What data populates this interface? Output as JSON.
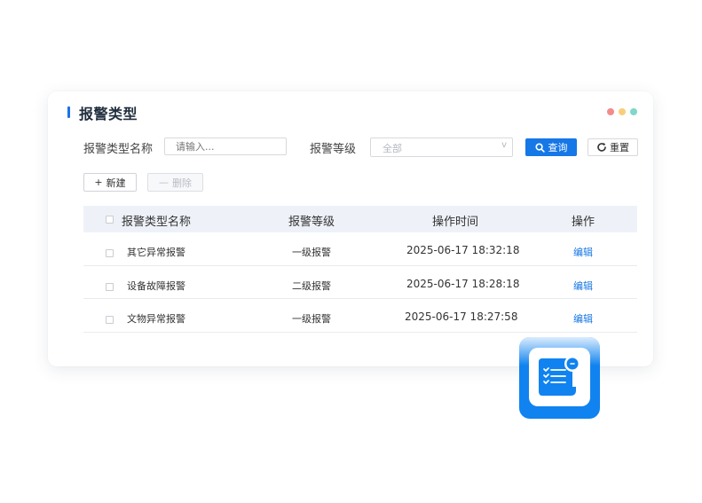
{
  "page": {
    "title": "报警类型",
    "window_dots": [
      "#f48b8b",
      "#f7cf7b",
      "#7fd8c8"
    ]
  },
  "filters": {
    "name_label": "报警类型名称",
    "name_placeholder": "请输入...",
    "level_label": "报警等级",
    "level_value": "全部",
    "level_arrow": "v",
    "query_label": "查询",
    "reset_label": "重置"
  },
  "toolbar": {
    "new_label": "新建",
    "new_symbol": "+",
    "delete_label": "删除",
    "delete_symbol": "—"
  },
  "table": {
    "columns": [
      "报警类型名称",
      "报警等级",
      "操作时间",
      "操作"
    ],
    "rows": [
      {
        "name": "其它异常报警",
        "level": "一级报警",
        "time": "2025-06-17 18:32:18",
        "action": "编辑"
      },
      {
        "name": "设备故障报警",
        "level": "二级报警",
        "time": "2025-06-17 18:28:18",
        "action": "编辑"
      },
      {
        "name": "文物异常报警",
        "level": "一级报警",
        "time": "2025-06-17 18:27:58",
        "action": "编辑"
      }
    ]
  },
  "colors": {
    "accent": "#1677e6",
    "header_bg": "#eef2f8"
  },
  "icons": {
    "app": "document-checklist-icon",
    "query": "search-icon",
    "reset": "refresh-icon"
  }
}
